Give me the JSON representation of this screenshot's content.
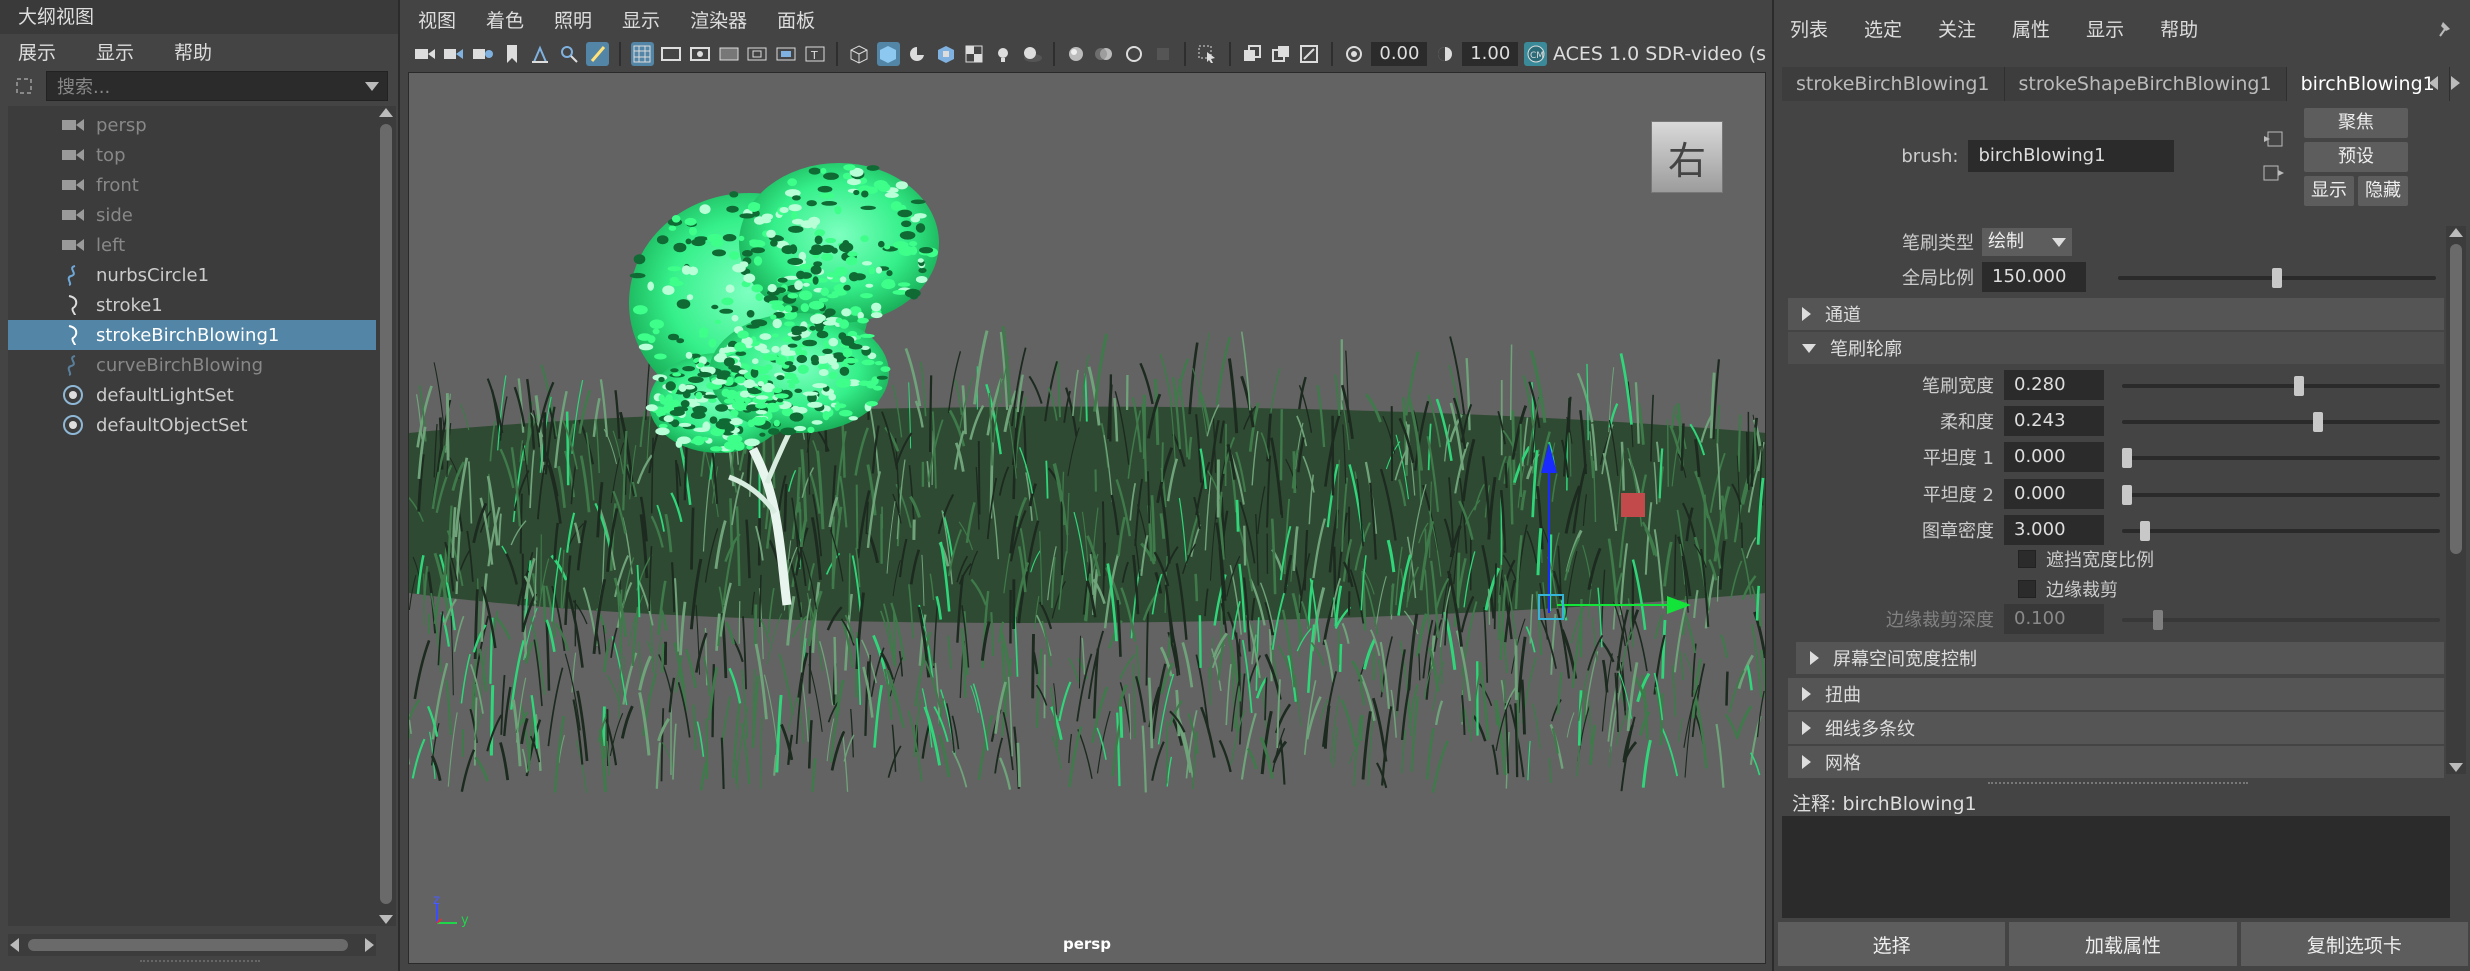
{
  "outliner": {
    "title": "大纲视图",
    "menu": [
      "展示",
      "显示",
      "帮助"
    ],
    "search_placeholder": "搜索...",
    "items": [
      {
        "label": "persp",
        "type": "camera",
        "dim": true
      },
      {
        "label": "top",
        "type": "camera",
        "dim": true
      },
      {
        "label": "front",
        "type": "camera",
        "dim": true
      },
      {
        "label": "side",
        "type": "camera",
        "dim": true
      },
      {
        "label": "left",
        "type": "camera",
        "dim": true
      },
      {
        "label": "nurbsCircle1",
        "type": "curve",
        "dim": false
      },
      {
        "label": "stroke1",
        "type": "stroke",
        "dim": false
      },
      {
        "label": "strokeBirchBlowing1",
        "type": "stroke",
        "dim": false,
        "selected": true
      },
      {
        "label": "curveBirchBlowing",
        "type": "curve",
        "dim": true
      },
      {
        "label": "defaultLightSet",
        "type": "set",
        "dim": false
      },
      {
        "label": "defaultObjectSet",
        "type": "set",
        "dim": false
      }
    ]
  },
  "viewport": {
    "menu": [
      "视图",
      "着色",
      "照明",
      "显示",
      "渲染器",
      "面板"
    ],
    "exposure": "0.00",
    "gamma": "1.00",
    "color_space": "ACES 1.0 SDR-video (s",
    "viewcube_label": "右",
    "camera_label": "persp",
    "axis_z": "z",
    "axis_y": "y"
  },
  "attribute_editor": {
    "menu": [
      "列表",
      "选定",
      "关注",
      "属性",
      "显示",
      "帮助"
    ],
    "tabs": [
      "strokeBirchBlowing1",
      "strokeShapeBirchBlowing1",
      "birchBlowing1"
    ],
    "active_tab": 2,
    "brush_label": "brush:",
    "brush_value": "birchBlowing1",
    "btn_focus": "聚焦",
    "btn_presets": "预设",
    "btn_show": "显示",
    "btn_hide": "隐藏",
    "brush_type_label": "笔刷类型",
    "brush_type_value": "绘制",
    "global_scale_label": "全局比例",
    "global_scale_value": "150.000",
    "global_scale_fraction": 0.5,
    "sections": {
      "channels": "通道",
      "brush_profile": "笔刷轮廓",
      "screen_space_width": "屏幕空间宽度控制",
      "twist": "扭曲",
      "thin_line_multi": "细线多条纹",
      "mesh": "网格"
    },
    "profile": [
      {
        "label": "笔刷宽度",
        "value": "0.280",
        "fraction": 0.56
      },
      {
        "label": "柔和度",
        "value": "0.243",
        "fraction": 0.62
      },
      {
        "label": "平坦度 1",
        "value": "0.000",
        "fraction": 0.0
      },
      {
        "label": "平坦度 2",
        "value": "0.000",
        "fraction": 0.0
      },
      {
        "label": "图章密度",
        "value": "3.000",
        "fraction": 0.06
      }
    ],
    "occlusion_width_scale": "遮挡宽度比例",
    "edge_clip": "边缘裁剪",
    "edge_clip_depth_label": "边缘裁剪深度",
    "edge_clip_depth_value": "0.100",
    "edge_clip_depth_fraction": 0.1,
    "notes_label": "注释:  birchBlowing1",
    "bottom_buttons": [
      "选择",
      "加载属性",
      "复制选项卡"
    ]
  },
  "colors": {
    "selection": "#5285a6",
    "tree_green": "#3dff8a",
    "manip_blue": "#1a2bff",
    "manip_green": "#12e43a",
    "manip_red": "#c24a4a"
  }
}
